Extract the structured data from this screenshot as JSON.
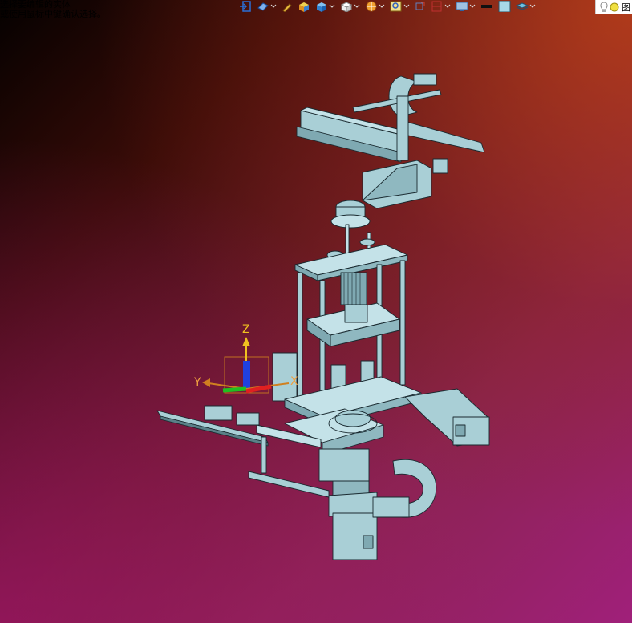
{
  "viewport": {
    "hint_lines": [
      "选择要编辑的实体",
      "或使用鼠标中键确认选择。"
    ],
    "triad": {
      "z_label": "Z",
      "y_label": "Y",
      "x_label": "X"
    }
  },
  "toolbar": {
    "items": [
      {
        "name": "exit-icon",
        "color": "#2a6fd6"
      },
      {
        "name": "view-orient-icon",
        "color": "#2a6fd6"
      },
      {
        "name": "pencil-icon",
        "color": "#e0a020"
      },
      {
        "name": "shaded-box-icon",
        "color": "#e0b020"
      },
      {
        "name": "wire-box-icon",
        "color": "#3a8fe0"
      },
      {
        "name": "white-box-icon",
        "color": "#ffffff"
      },
      {
        "name": "render-icon",
        "color": "#f0a030"
      },
      {
        "name": "zoom-icon",
        "color": "#f0c040"
      },
      {
        "name": "filter-icon",
        "color": "#d04030"
      },
      {
        "name": "section-icon",
        "color": "#c03030"
      },
      {
        "name": "display-icon",
        "color": "#5080c0"
      },
      {
        "name": "line-style-icon",
        "color": "#000000"
      },
      {
        "name": "color-swatch-icon",
        "color": "#a8d8e8"
      },
      {
        "name": "layer-icon",
        "color": "#50a0c0"
      }
    ]
  },
  "hover_panel": {
    "label": "图"
  },
  "colors": {
    "part": "#a9cfd6",
    "edge": "#1a2a30",
    "shade": "#7fa9b2"
  }
}
